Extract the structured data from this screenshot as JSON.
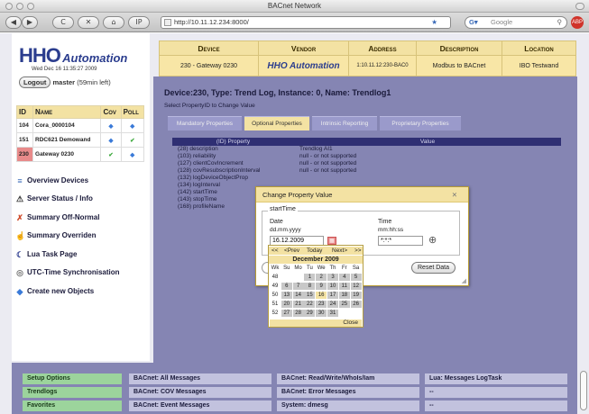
{
  "window": {
    "title": "BACnet Network"
  },
  "browser": {
    "back": "◀",
    "forward": "▶",
    "reload": "C",
    "stop": "✕",
    "home": "⌂",
    "ip": "IP",
    "url": "http://10.11.12.234:8000/",
    "search_placeholder": "Google"
  },
  "brand": {
    "name1": "HHO",
    "name2": "Automation",
    "datetime": "Wed Dec 16 11:35:27 2009"
  },
  "session": {
    "logout": "Logout",
    "user": "master",
    "time_left": "(59min left)"
  },
  "devices_header": [
    "ID",
    "Name",
    "Cov",
    "Poll"
  ],
  "devices": [
    {
      "id": "104",
      "name": "Cora_0000104",
      "cov": "◆",
      "poll": "◆",
      "id_color": "#ffffff"
    },
    {
      "id": "151",
      "name": "RDC621 Demowand",
      "cov": "◆",
      "poll": "✔",
      "id_color": "#ffffff"
    },
    {
      "id": "230",
      "name": "Gateway 0230",
      "cov": "✔",
      "poll": "◆",
      "id_color": "#e88a8a"
    }
  ],
  "nav": [
    {
      "label": "Overview Devices",
      "icon": "≡"
    },
    {
      "label": "Server Status / Info",
      "icon": "⚠"
    },
    {
      "label": "Summary Off-Normal",
      "icon": "✗"
    },
    {
      "label": "Summary Overriden",
      "icon": "☝"
    },
    {
      "label": "Lua Task Page",
      "icon": "☾"
    },
    {
      "label": "UTC-Time Synchronisation",
      "icon": "◎"
    },
    {
      "label": "Create new Objects",
      "icon": "◆"
    }
  ],
  "device_table": {
    "headers": [
      "Device",
      "Vendor",
      "Address",
      "Description",
      "Location"
    ],
    "row": {
      "device": "230 - Gateway 0230",
      "vendor": "HHO Automation",
      "address": "1:10.11.12:230-BAC0",
      "description": "Modbus to BACnet",
      "location": "IBO Testwand"
    }
  },
  "heading": "Device:230, Type: Trend Log, Instance: 0, Name: Trendlog1",
  "subheading": "Select PropertyID to Change Value",
  "tabs": [
    "Mandatory Properties",
    "Optional Properties",
    "Intrinsic Reporting",
    "Proprietary Properties"
  ],
  "prop_headers": [
    "(ID) Property",
    "Value"
  ],
  "properties": [
    {
      "p": "(28) description",
      "v": "Trendlog AI1"
    },
    {
      "p": "(103) reliability",
      "v": "null - or not supported"
    },
    {
      "p": "(127) clientCovIncrement",
      "v": "null - or not supported"
    },
    {
      "p": "(128) covResubscriptionInterval",
      "v": "null - or not supported"
    },
    {
      "p": "(132) logDeviceObjectProp",
      "v": ""
    },
    {
      "p": "(134) logInterval",
      "v": ""
    },
    {
      "p": "(142) startTime",
      "v": ""
    },
    {
      "p": "(143) stopTime",
      "v": ""
    },
    {
      "p": "(168) profileName",
      "v": ""
    }
  ],
  "dialog": {
    "title": "Change Property Value",
    "close": "✕",
    "group": "startTime",
    "date_label": "Date",
    "date_format": "dd.mm.yyyy",
    "date_value": "16.12.2009",
    "time_label": "Time",
    "time_format": "mm:hh:ss",
    "time_value": "*:*:*",
    "reset": "Reset Data"
  },
  "calendar": {
    "nav": [
      "<<",
      "<Prev",
      "Today",
      "Next>",
      ">>"
    ],
    "month": "December 2009",
    "weekdays": [
      "Wk",
      "Su",
      "Mo",
      "Tu",
      "We",
      "Th",
      "Fr",
      "Sa"
    ],
    "weeks": [
      [
        "48",
        "",
        "",
        "1",
        "2",
        "3",
        "4",
        "5"
      ],
      [
        "49",
        "6",
        "7",
        "8",
        "9",
        "10",
        "11",
        "12"
      ],
      [
        "50",
        "13",
        "14",
        "15",
        "16",
        "17",
        "18",
        "19"
      ],
      [
        "51",
        "20",
        "21",
        "22",
        "23",
        "24",
        "25",
        "26"
      ],
      [
        "52",
        "27",
        "28",
        "29",
        "30",
        "31",
        "",
        ""
      ]
    ],
    "close": "Close"
  },
  "bottom": {
    "col1": [
      "Setup Options",
      "Trendlogs",
      "Favorites"
    ],
    "col2": [
      "BACnet: All Messages",
      "BACnet: COV Messages",
      "BACnet: Event Messages"
    ],
    "col3": [
      "BACnet: Read/Write/WhoIs/Iam",
      "BACnet: Error Messages",
      "System: dmesg"
    ],
    "col4": [
      "Lua: Messages LogTask",
      "--",
      "--"
    ]
  }
}
